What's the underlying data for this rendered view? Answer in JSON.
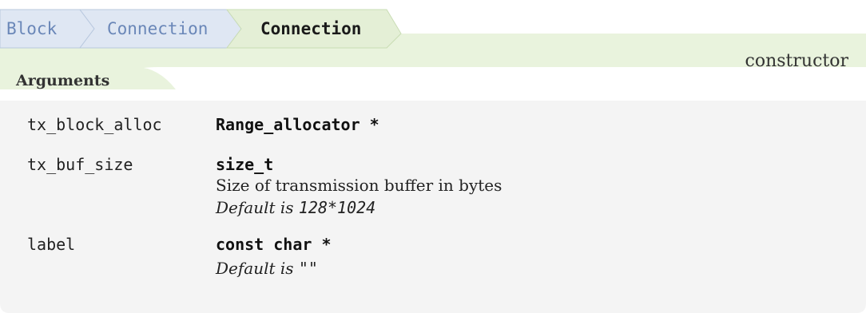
{
  "breadcrumb": {
    "items": [
      {
        "label": "Block",
        "current": false
      },
      {
        "label": "Connection",
        "current": false
      },
      {
        "label": "Connection",
        "current": true
      }
    ]
  },
  "kind_label": "constructor",
  "section_title": "Arguments",
  "arguments": [
    {
      "name": "tx_block_alloc",
      "type": "Range_allocator *",
      "description": "",
      "default_prefix": "",
      "default_value": ""
    },
    {
      "name": "tx_buf_size",
      "type": "size_t",
      "description": "Size of transmission buffer in bytes",
      "default_prefix": "Default is",
      "default_value": "128*1024"
    },
    {
      "name": "label",
      "type": "const char *",
      "description": "",
      "default_prefix": "Default is",
      "default_value": "\"\""
    }
  ],
  "colors": {
    "band_green": "#e9f3dd",
    "band_green_edge": "#c9dcb4",
    "crumb_blue_fill": "#dfe7f3",
    "crumb_link_text": "#6a87b8",
    "panel_gray": "#f4f4f4"
  }
}
